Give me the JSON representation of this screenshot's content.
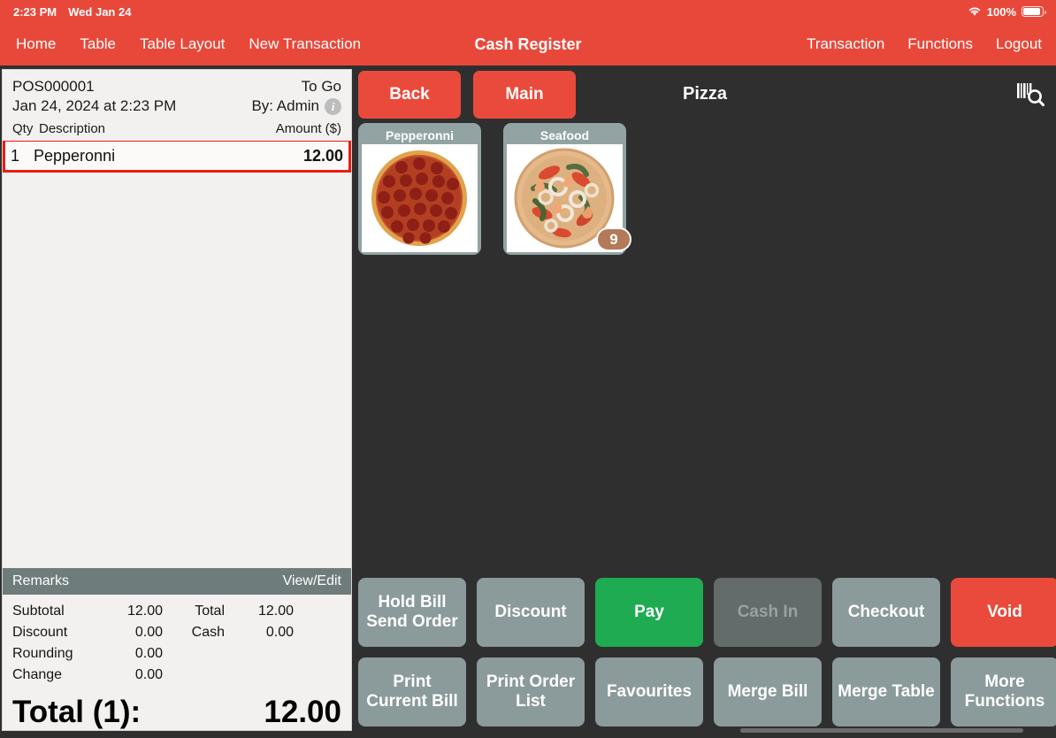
{
  "statusbar": {
    "time": "2:23 PM",
    "date": "Wed Jan 24",
    "battery_percent": "100%",
    "wifi_icon": "wifi-icon",
    "battery_icon": "battery-icon"
  },
  "navbar": {
    "title": "Cash Register",
    "left_items": [
      {
        "label": "Home",
        "name": "nav-home"
      },
      {
        "label": "Table",
        "name": "nav-table"
      },
      {
        "label": "Table Layout",
        "name": "nav-table-layout"
      },
      {
        "label": "New Transaction",
        "name": "nav-new-transaction"
      }
    ],
    "right_items": [
      {
        "label": "Transaction",
        "name": "nav-transaction"
      },
      {
        "label": "Functions",
        "name": "nav-functions"
      },
      {
        "label": "Logout",
        "name": "nav-logout"
      }
    ]
  },
  "receipt": {
    "bill_no": "POS000001",
    "order_type": "To Go",
    "datetime": "Jan 24, 2024 at 2:23 PM",
    "cashier": "By: Admin",
    "info_icon": "info-icon",
    "columns": {
      "qty": "Qty",
      "description": "Description",
      "amount": "Amount ($)"
    },
    "items": [
      {
        "qty": "1",
        "description": "Pepperonni",
        "amount": "12.00",
        "selected": true
      }
    ],
    "remarks": {
      "label": "Remarks",
      "action": "View/Edit"
    },
    "summary": {
      "subtotal_label": "Subtotal",
      "subtotal_value": "12.00",
      "total_label": "Total",
      "total_value": "12.00",
      "discount_label": "Discount",
      "discount_value": "0.00",
      "cash_label": "Cash",
      "cash_value": "0.00",
      "rounding_label": "Rounding",
      "rounding_value": "0.00",
      "change_label": "Change",
      "change_value": "0.00"
    },
    "grand_total_label": "Total (1):",
    "grand_total_value": "12.00"
  },
  "main": {
    "category_title": "Pizza",
    "scan_icon": "barcode-search-icon",
    "nav_buttons": [
      {
        "label": "Back",
        "name": "back-button"
      },
      {
        "label": "Main",
        "name": "main-button"
      }
    ],
    "products": [
      {
        "name": "Pepperonni",
        "image": "pepperoni-pizza-image",
        "badge": ""
      },
      {
        "name": "Seafood",
        "image": "seafood-pizza-image",
        "badge": "9"
      }
    ]
  },
  "actions": [
    {
      "label": "Hold Bill\nSend Order",
      "name": "hold-bill-send-order-button",
      "style": "default",
      "disabled": false
    },
    {
      "label": "Discount",
      "name": "discount-button",
      "style": "default",
      "disabled": false
    },
    {
      "label": "Pay",
      "name": "pay-button",
      "style": "pay",
      "disabled": false
    },
    {
      "label": "Cash In",
      "name": "cash-in-button",
      "style": "disabled",
      "disabled": true
    },
    {
      "label": "Checkout",
      "name": "checkout-button",
      "style": "default",
      "disabled": false
    },
    {
      "label": "Void",
      "name": "void-button",
      "style": "void",
      "disabled": false
    },
    {
      "label": "Print\nCurrent Bill",
      "name": "print-current-bill-button",
      "style": "default",
      "disabled": false
    },
    {
      "label": "Print Order\nList",
      "name": "print-order-list-button",
      "style": "default",
      "disabled": false
    },
    {
      "label": "Favourites",
      "name": "favourites-button",
      "style": "default",
      "disabled": false
    },
    {
      "label": "Merge Bill",
      "name": "merge-bill-button",
      "style": "default",
      "disabled": false
    },
    {
      "label": "Merge Table",
      "name": "merge-table-button",
      "style": "default",
      "disabled": false
    },
    {
      "label": "More\nFunctions",
      "name": "more-functions-button",
      "style": "default",
      "disabled": false
    }
  ],
  "colors": {
    "brand_red": "#e8483a",
    "pay_green": "#1eab52",
    "button_gray": "#8b9a9a",
    "disabled_gray": "#636b6b",
    "tile_gray": "#93a3a3",
    "remarks_gray": "#6f7c7c",
    "selection_red": "#ef1b12",
    "badge_brown": "#b27a58",
    "background_dark": "#2f2f2f",
    "receipt_paper": "#f2f1ef"
  }
}
